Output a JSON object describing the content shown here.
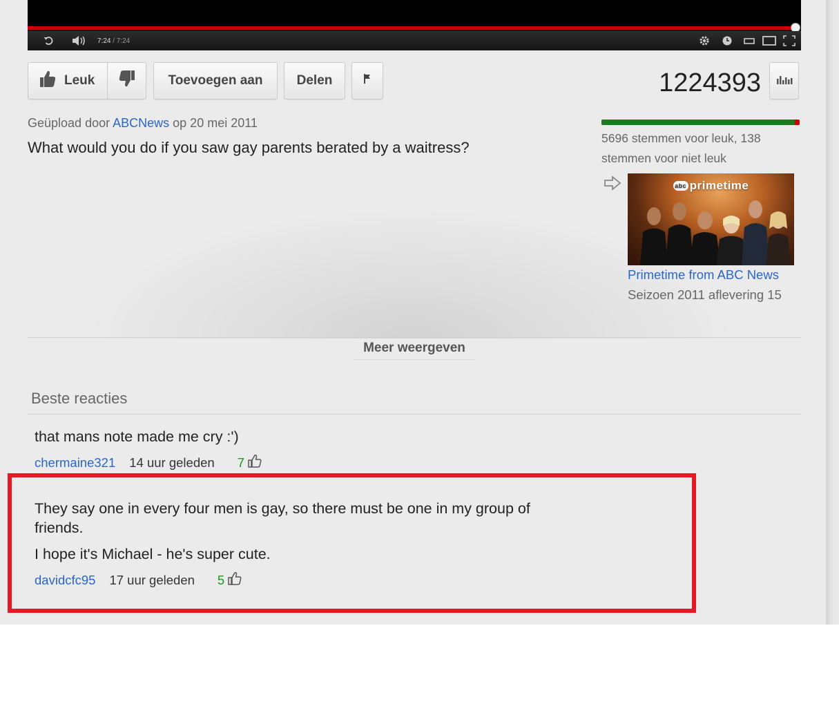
{
  "player": {
    "current_time": "7:24",
    "duration": "/ 7:24",
    "progress_fraction": 1.0
  },
  "actions": {
    "like_label": "Leuk",
    "add_label": "Toevoegen aan",
    "share_label": "Delen"
  },
  "stats": {
    "views": "1224393",
    "like_fraction": 0.976,
    "votes_text": "5696 stemmen voor leuk, 138 stemmen voor niet leuk"
  },
  "upload": {
    "prefix": "Geüpload door",
    "channel": "ABCNews",
    "date": "op 20 mei 2011"
  },
  "video": {
    "description": "What would you do if you saw gay parents berated by a waitress?"
  },
  "show": {
    "thumbnail_text": "primetime",
    "thumbnail_badge": "abc",
    "title": "Primetime from ABC News",
    "subtitle": "Seizoen 2011 aflevering 15"
  },
  "more_label": "Meer weergeven",
  "comments_heading": "Beste reacties",
  "comments": [
    {
      "lines": [
        "that mans note made me cry :')"
      ],
      "user": "chermaine321",
      "time": "14 uur geleden",
      "likes": "7"
    },
    {
      "lines": [
        "They say one in every four men is gay, so there must be one in my group of",
        "friends.",
        "I hope it's Michael - he's super cute."
      ],
      "user": "davidcfc95",
      "time": "17 uur geleden",
      "likes": "5"
    }
  ],
  "colors": {
    "link": "#2a66c9",
    "highlight": "#e31a26",
    "likes_green": "#1a9a1a",
    "progress_red": "#cc0000"
  }
}
